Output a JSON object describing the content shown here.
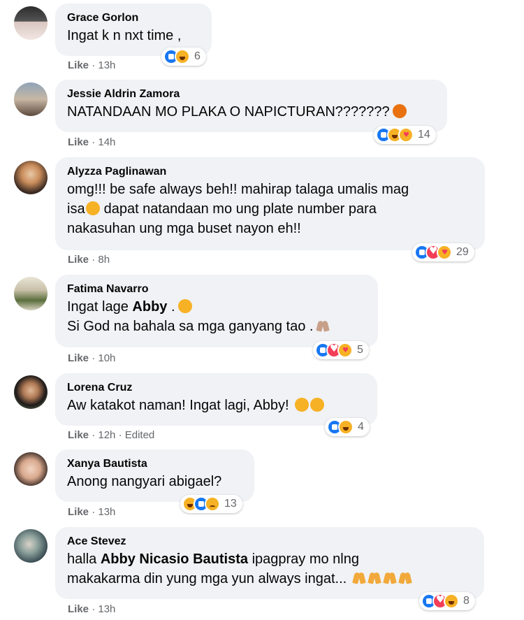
{
  "colors": {
    "bubble": "#f0f2f5",
    "meta": "#65676b",
    "like_blue": "#1877f2",
    "love_red": "#f33e58",
    "emoji_yellow": "#f7b125"
  },
  "comments": [
    {
      "name": "Grace Gorlon",
      "text": "Ingat k n nxt time ,",
      "reactions": [
        "like",
        "haha"
      ],
      "count": "6",
      "action": "Like",
      "sep": "·",
      "time": "13h"
    },
    {
      "name": "Jessie Aldrin Zamora",
      "text": "NATANDAAN MO PLAKA O NAPICTURAN???????",
      "emoji": "angry-face",
      "reactions": [
        "like",
        "haha",
        "care"
      ],
      "count": "14",
      "action": "Like",
      "sep": "·",
      "time": "14h"
    },
    {
      "name": "Alyzza Paglinawan",
      "lines": [
        "omg!!! be safe always beh!! mahirap talaga umalis mag",
        "isa",
        "dapat natandaan mo ung plate number para",
        "nakasuhan ung mga buset nayon eh!!"
      ],
      "emoji": "crying-face",
      "reactions": [
        "like",
        "love",
        "care"
      ],
      "count": "29",
      "action": "Like",
      "sep": "·",
      "time": "8h"
    },
    {
      "name": "Fatima Navarro",
      "line1_pre": "Ingat lage",
      "line1_tag": "Abby",
      "line1_post": ".",
      "line2": "Si God na bahala sa mga ganyang tao .",
      "reactions": [
        "like",
        "love",
        "care"
      ],
      "count": "5",
      "action": "Like",
      "sep": "·",
      "time": "10h"
    },
    {
      "name": "Lorena Cruz",
      "text": "Aw katakot naman! Ingat lagi, Abby!",
      "reactions": [
        "like",
        "haha"
      ],
      "count": "4",
      "action": "Like",
      "sep": "·",
      "time": "12h",
      "edited": "Edited"
    },
    {
      "name": "Xanya Bautista",
      "text": "Anong nangyari abigael?",
      "reactions": [
        "haha",
        "like",
        "sad"
      ],
      "count": "13",
      "action": "Like",
      "sep": "·",
      "time": "13h"
    },
    {
      "name": "Ace Stevez",
      "line1_pre": "halla",
      "line1_tag": "Abby Nicasio Bautista",
      "line1_post": "ipagpray mo nlng",
      "line2": "makakarma din yung mga yun always ingat...",
      "reactions": [
        "like",
        "love",
        "haha"
      ],
      "count": "8",
      "action": "Like",
      "sep": "·",
      "time": "13h"
    }
  ]
}
